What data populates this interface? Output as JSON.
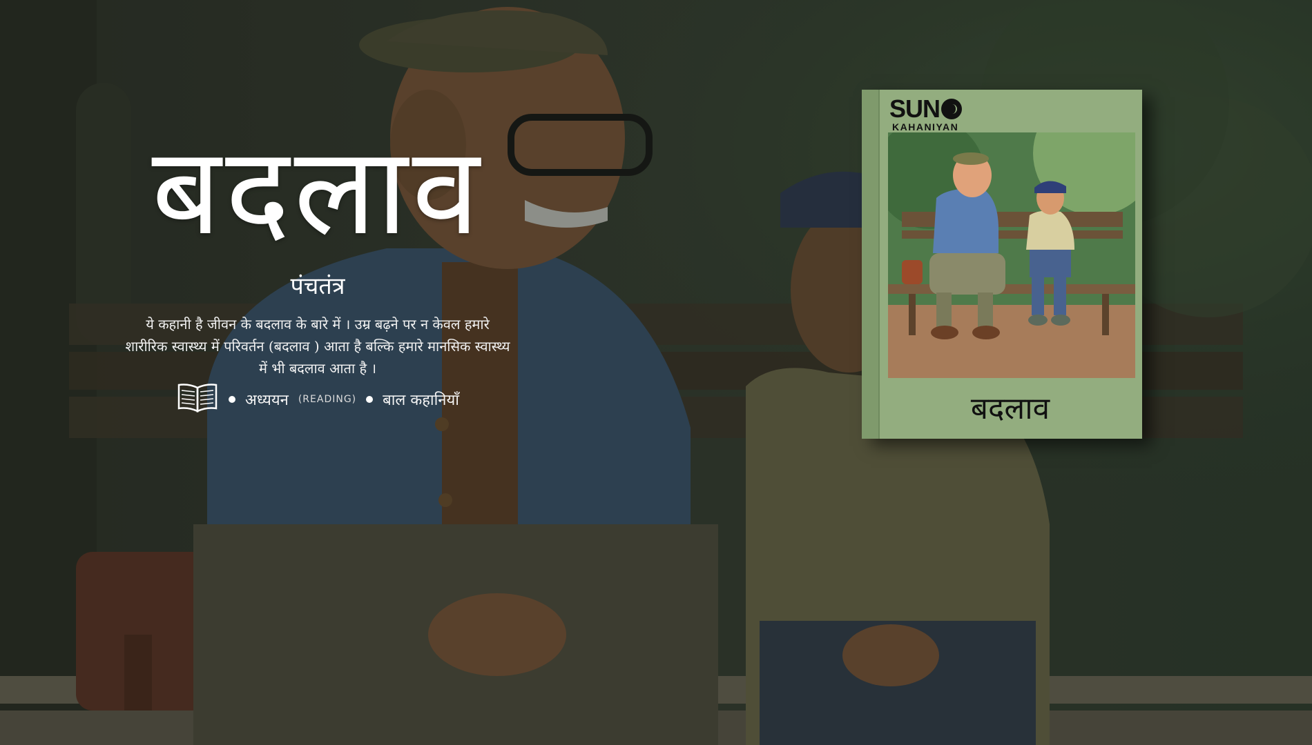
{
  "hero": {
    "title": "बदलाव",
    "subtitle": "पंचतंत्र",
    "description": "ये कहानी है जीवन के बदलाव के बारे में । उम्र बढ़ने पर न केवल हमारे शारीरिक स्वास्थ्य में परिवर्तन (बदलाव ) आता है बल्कि हमारे मानसिक स्वास्थ्य में भी बदलाव आता है ।",
    "meta": {
      "icon": "open-book-icon",
      "category": "अध्ययन",
      "category_english": "(READING)",
      "tag": "बाल कहानियाँ"
    }
  },
  "cover": {
    "logo_main": "SUN",
    "logo_sub": "KAHANIYAN",
    "title": "बदलाव",
    "color": "#93ad7f"
  }
}
